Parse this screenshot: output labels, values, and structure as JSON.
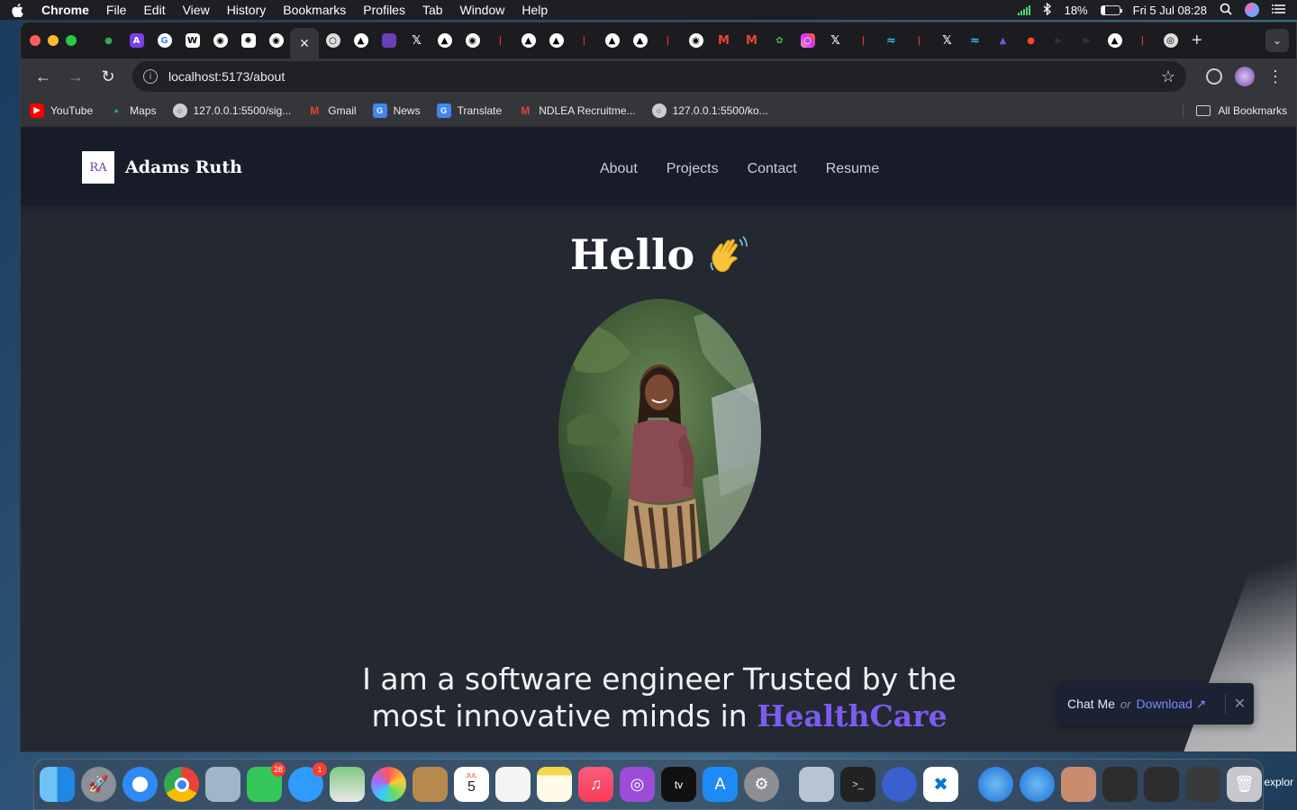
{
  "menubar": {
    "app": "Chrome",
    "menus": [
      "File",
      "Edit",
      "View",
      "History",
      "Bookmarks",
      "Profiles",
      "Tab",
      "Window",
      "Help"
    ],
    "battery": "18%",
    "datetime": "Fri 5 Jul  08:28"
  },
  "browser": {
    "url": "localhost:5173/about",
    "bookmarks": [
      {
        "label": "YouTube",
        "icon": "youtube-icon",
        "color": "#ff0000"
      },
      {
        "label": "Maps",
        "icon": "maps-icon",
        "color": "#34a853"
      },
      {
        "label": "127.0.0.1:5500/sig...",
        "icon": "globe-icon",
        "color": "#aaaaaa"
      },
      {
        "label": "Gmail",
        "icon": "gmail-icon",
        "color": "#ea4335"
      },
      {
        "label": "News",
        "icon": "news-icon",
        "color": "#4285f4"
      },
      {
        "label": "Translate",
        "icon": "translate-icon",
        "color": "#4285f4"
      },
      {
        "label": "NDLEA Recruitme...",
        "icon": "gmail-icon",
        "color": "#ea4335"
      },
      {
        "label": "127.0.0.1:5500/ko...",
        "icon": "globe-icon",
        "color": "#aaaaaa"
      }
    ],
    "all_bookmarks": "All Bookmarks"
  },
  "site": {
    "logo_text": "RA",
    "brand": "Adams Ruth",
    "nav": [
      "About",
      "Projects",
      "Contact",
      "Resume"
    ],
    "greeting": "Hello",
    "tagline_line1": "I am a software engineer Trusted by the",
    "tagline_line2_prefix": "most innovative minds in ",
    "tagline_highlight": "HealthCare",
    "chat_label": "Chat Me",
    "or_label": "or",
    "download_label": "Download ↗",
    "close_label": "✕",
    "accent_color": "#7b5cf0"
  },
  "dock": {
    "messages_badge": "28",
    "mail_badge": "1",
    "calendar_day": "5",
    "calendar_month": "JUL",
    "trailing_label": "explor"
  }
}
